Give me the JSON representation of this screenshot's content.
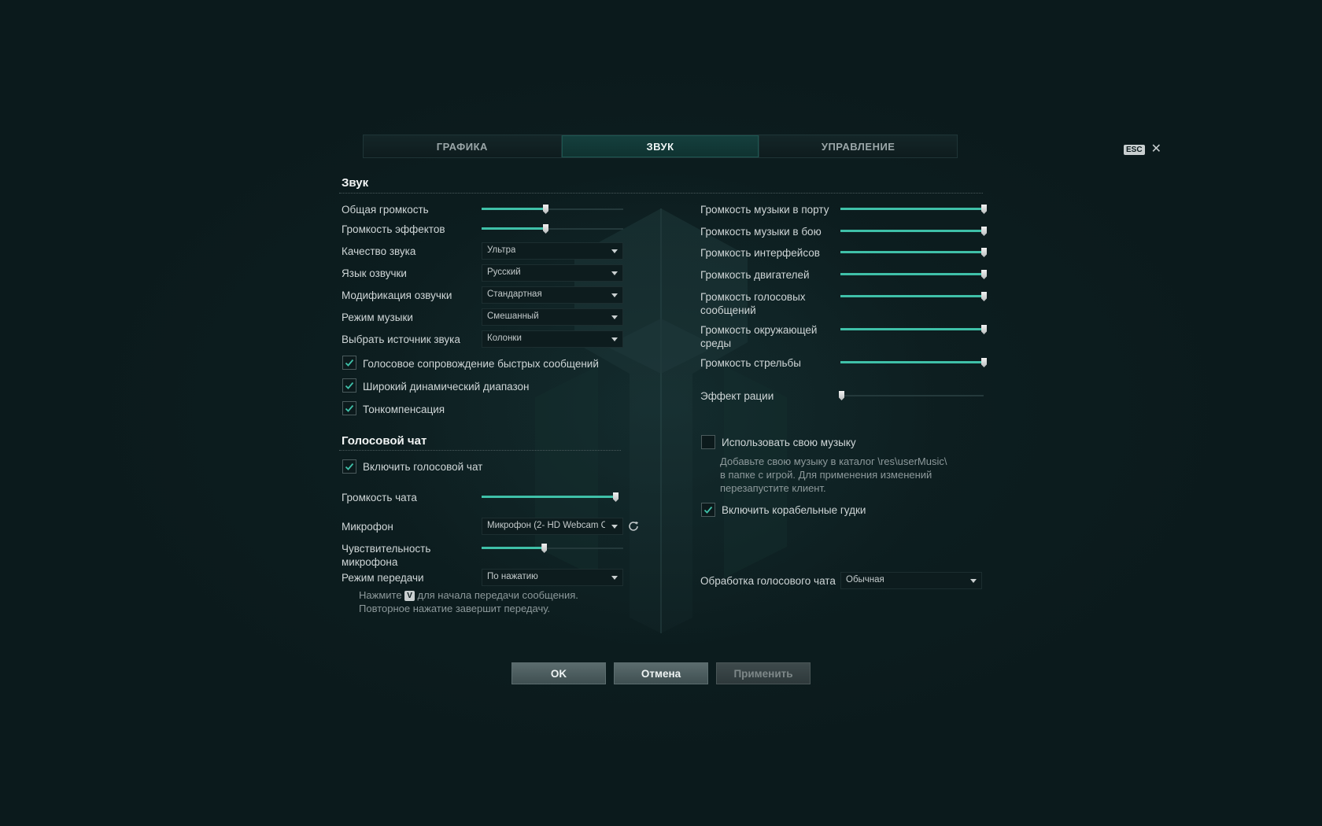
{
  "tabs": [
    {
      "label": "ГРАФИКА",
      "active": false
    },
    {
      "label": "ЗВУК",
      "active": true
    },
    {
      "label": "УПРАВЛЕНИЕ",
      "active": false
    }
  ],
  "close": {
    "key_label": "ESC",
    "icon": "close-icon"
  },
  "sound": {
    "title": "Звук",
    "sliders": [
      {
        "label": "Общая громкость",
        "value": 0.45
      },
      {
        "label": "Громкость эффектов",
        "value": 0.45
      }
    ],
    "selects": [
      {
        "label": "Качество звука",
        "value": "Ультра"
      },
      {
        "label": "Язык озвучки",
        "value": "Русский"
      },
      {
        "label": "Модификация озвучки",
        "value": "Стандартная"
      },
      {
        "label": "Режим музыки",
        "value": "Смешанный"
      },
      {
        "label": "Выбрать источник звука",
        "value": "Колонки"
      }
    ],
    "checkboxes": [
      {
        "label": "Голосовое сопровождение быстрых сообщений",
        "checked": true
      },
      {
        "label": "Широкий динамический диапазон",
        "checked": true
      },
      {
        "label": "Тонкомпенсация",
        "checked": true
      }
    ]
  },
  "right_sliders": [
    {
      "label": "Громкость музыки в порту",
      "value": 1.0
    },
    {
      "label": "Громкость музыки в бою",
      "value": 1.0
    },
    {
      "label": "Громкость интерфейсов",
      "value": 1.0
    },
    {
      "label": "Громкость двигателей",
      "value": 1.0
    },
    {
      "label": "Громкость голосовых сообщений",
      "value": 1.0
    },
    {
      "label": "Громкость окружающей среды",
      "value": 1.0
    },
    {
      "label": "Громкость стрельбы",
      "value": 1.0
    },
    {
      "label": "Эффект рации",
      "value": 0.0
    }
  ],
  "user_music": {
    "label": "Использовать свою музыку",
    "checked": false,
    "hint_lines": [
      "Добавьте свою музыку в каталог \\res\\userMusic\\",
      "в папке с игрой. Для применения изменений",
      "перезапустите клиент."
    ]
  },
  "ship_horns": {
    "label": "Включить корабельные гудки",
    "checked": true
  },
  "voice_chat": {
    "title": "Голосовой чат",
    "enable": {
      "label": "Включить голосовой чат",
      "checked": true
    },
    "volume": {
      "label": "Громкость чата",
      "value": 1.0
    },
    "mic": {
      "label": "Микрофон",
      "value": "Микрофон (2- HD Webcam C"
    },
    "sensitivity": {
      "label": "Чувствительность микрофона",
      "value": 0.44
    },
    "transmit": {
      "label": "Режим передачи",
      "value": "По нажатию"
    },
    "hint_prefix": "Нажмите",
    "hint_key": "V",
    "hint_suffix": "для начала передачи сообщения.",
    "hint_line2": "Повторное нажатие завершит передачу.",
    "processing": {
      "label": "Обработка голосового чата",
      "value": "Обычная"
    }
  },
  "buttons": {
    "ok": "OK",
    "cancel": "Отмена",
    "apply": "Применить"
  },
  "colors": {
    "accent": "#3fc0a8",
    "active_tab": "#15403e",
    "background": "#0b1a1c"
  }
}
